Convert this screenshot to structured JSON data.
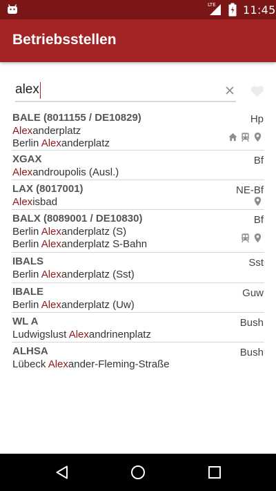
{
  "status_bar": {
    "time": "11:45",
    "network": "LTE"
  },
  "app_bar": {
    "title": "Betriebsstellen"
  },
  "search": {
    "value": "alex",
    "placeholder": ""
  },
  "results": [
    {
      "code": "BALE (8011155 / DE10829)",
      "type": "Hp",
      "names": [
        [
          "",
          "Alex",
          "anderplatz"
        ],
        [
          "Berlin ",
          "Alex",
          "anderplatz"
        ]
      ],
      "icons": [
        "house-icon",
        "train-icon",
        "location-pin-icon"
      ]
    },
    {
      "code": "XGAX",
      "type": "Bf",
      "names": [
        [
          "",
          "Alex",
          "androupolis (Ausl.)"
        ]
      ],
      "icons": []
    },
    {
      "code": "LAX (8017001)",
      "type": "NE-Bf",
      "names": [
        [
          "",
          "Alex",
          "isbad"
        ]
      ],
      "icons": [
        "location-pin-icon"
      ]
    },
    {
      "code": "BALX (8089001 / DE10830)",
      "type": "Bf",
      "names": [
        [
          "Berlin ",
          "Alex",
          "anderplatz (S)"
        ],
        [
          "Berlin ",
          "Alex",
          "anderplatz S-Bahn"
        ]
      ],
      "icons": [
        "train-icon",
        "location-pin-icon"
      ]
    },
    {
      "code": "IBALS",
      "type": "Sst",
      "names": [
        [
          "Berlin ",
          "Alex",
          "anderplatz (Sst)"
        ]
      ],
      "icons": []
    },
    {
      "code": "IBALE",
      "type": "Guw",
      "names": [
        [
          "Berlin ",
          "Alex",
          "anderplatz (Uw)"
        ]
      ],
      "icons": []
    },
    {
      "code": "WL A",
      "type": "Bush",
      "names": [
        [
          "Ludwigslust ",
          "Alex",
          "andrinenplatz"
        ]
      ],
      "icons": []
    },
    {
      "code": "ALHSA",
      "type": "Bush",
      "names": [
        [
          "Lübeck ",
          "Alex",
          "ander-Fleming-Straße"
        ]
      ],
      "icons": []
    }
  ],
  "colors": {
    "status_bar": "#7a1616",
    "app_bar": "#a32424",
    "highlight": "#8b1a1a"
  }
}
